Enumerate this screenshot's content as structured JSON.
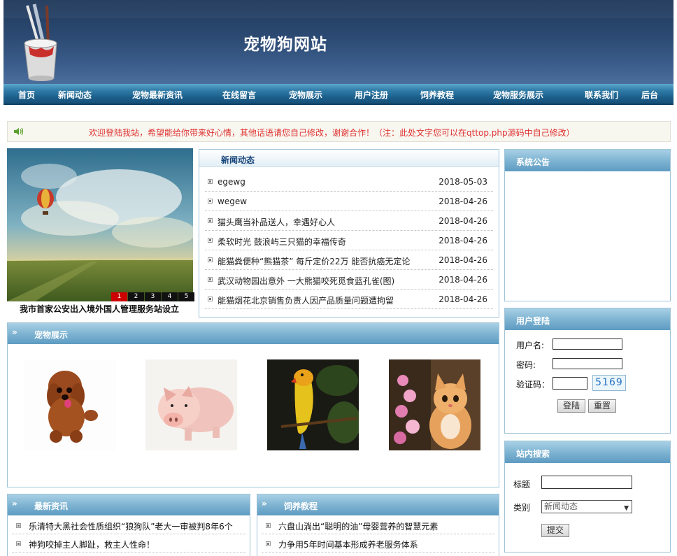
{
  "header": {
    "site_title": "宠物狗网站"
  },
  "nav": [
    {
      "label": "首页"
    },
    {
      "label": "新闻动态"
    },
    {
      "label": "宠物最新资讯"
    },
    {
      "label": "在线留言"
    },
    {
      "label": "宠物展示"
    },
    {
      "label": "用户注册"
    },
    {
      "label": "饲养教程"
    },
    {
      "label": "宠物服务展示"
    },
    {
      "label": "联系我们"
    },
    {
      "label": "后台"
    }
  ],
  "notice": {
    "text": "欢迎登陆我站，希望能给你带来好心情，其他话语请您自己修改，谢谢合作！（注：此处文字您可以在qttop.php源码中自己修改）",
    "icon": "speaker-icon"
  },
  "slideshow": {
    "pages": [
      "1",
      "2",
      "3",
      "4",
      "5"
    ],
    "active_page": "1",
    "caption": "我市首家公安出入境外国人管理服务站设立"
  },
  "news": {
    "title": "新闻动态",
    "items": [
      {
        "title": "egewg",
        "date": "2018-05-03"
      },
      {
        "title": "wegew",
        "date": "2018-04-26"
      },
      {
        "title": "猫头鹰当补品送人，幸遇好心人",
        "date": "2018-04-26"
      },
      {
        "title": "柔软时光 鼓浪屿三只猫的幸福传奇",
        "date": "2018-04-26"
      },
      {
        "title": "能猫粪便种“熊猫茶” 每斤定价22万 能否抗癌无定论",
        "date": "2018-04-26"
      },
      {
        "title": "武汉动物园出意外 一大熊猫咬死觅食蓝孔雀(图)",
        "date": "2018-04-26"
      },
      {
        "title": "能猫烟花北京销售负责人因产品质量问题遭拘留",
        "date": "2018-04-26"
      }
    ]
  },
  "announcement": {
    "title": "系统公告"
  },
  "login": {
    "title": "用户登陆",
    "username_label": "用户名:",
    "password_label": "密码:",
    "captcha_label": "验证码：",
    "captcha_code": "5169",
    "login_button": "登陆",
    "reset_button": "重置"
  },
  "search": {
    "title": "站内搜索",
    "title_label": "标题",
    "category_label": "类别",
    "category_selected": "新闻动态",
    "submit_button": "提交"
  },
  "pets": {
    "title": "宠物展示",
    "arrow": "»",
    "items": [
      "poodle",
      "piglet",
      "parrot",
      "kitten"
    ]
  },
  "latest": {
    "title": "最新资讯",
    "arrow": "»",
    "items": [
      {
        "title": "乐清特大黑社会性质组织“狼狗队”老大一审被判8年6个"
      },
      {
        "title": "神狗咬掉主人脚趾，救主人性命！"
      }
    ]
  },
  "tutorial": {
    "title": "饲养教程",
    "arrow": "»",
    "items": [
      {
        "title": "六盘山淌出“聪明的油”母婴营养的智慧元素"
      },
      {
        "title": "力争用5年时间基本形成养老服务体系"
      }
    ]
  },
  "colors": {
    "header_dark": "#20395a",
    "nav_blue": "#1b5e8a",
    "panel_header": "#7fb4d2",
    "notice_red": "#e0302f"
  }
}
